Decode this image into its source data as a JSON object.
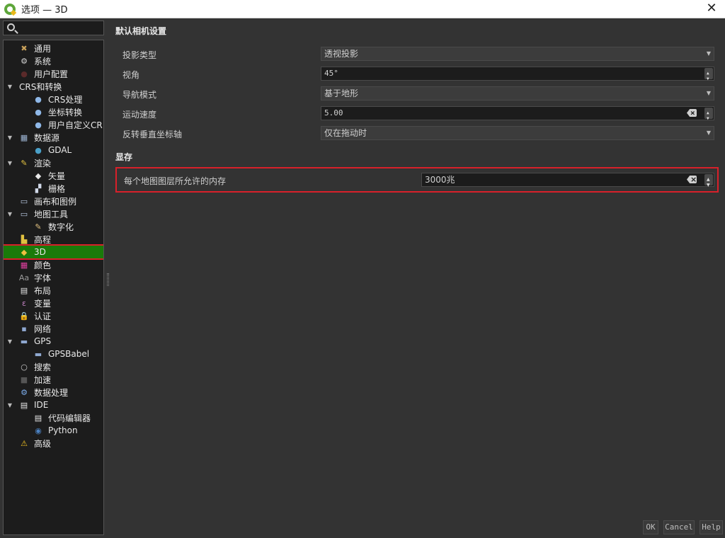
{
  "window": {
    "title": "选项 — 3D",
    "close": "✕"
  },
  "search": {
    "placeholder": ""
  },
  "tree": [
    {
      "label": "通用",
      "icon": "tools-icon",
      "glyph": "✖",
      "color": "#c9a15a",
      "level": 1,
      "arrow": ""
    },
    {
      "label": "系统",
      "icon": "system-gear-icon",
      "glyph": "⚙",
      "color": "#d8d8d8",
      "level": 1,
      "arrow": ""
    },
    {
      "label": "用户配置",
      "icon": "user-profile-icon",
      "glyph": "●",
      "color": "#5a2a2a",
      "level": 1,
      "arrow": ""
    },
    {
      "label": "CRS和转换",
      "icon": "",
      "glyph": "",
      "color": "",
      "level": 0,
      "arrow": "▼"
    },
    {
      "label": "CRS处理",
      "icon": "globe-icon",
      "glyph": "●",
      "color": "#8fb8e8",
      "level": 2,
      "arrow": ""
    },
    {
      "label": "坐标转换",
      "icon": "globe-transform-icon",
      "glyph": "●",
      "color": "#8fb8e8",
      "level": 2,
      "arrow": ""
    },
    {
      "label": "用户自定义CR",
      "icon": "globe-custom-icon",
      "glyph": "●",
      "color": "#8fb8e8",
      "level": 2,
      "arrow": ""
    },
    {
      "label": "数据源",
      "icon": "datasource-table-icon",
      "glyph": "▦",
      "color": "#9fb7d6",
      "level": 1,
      "arrow": "▼"
    },
    {
      "label": "GDAL",
      "icon": "gdal-globe-icon",
      "glyph": "●",
      "color": "#4aa0c8",
      "level": 2,
      "arrow": ""
    },
    {
      "label": "渲染",
      "icon": "brush-icon",
      "glyph": "✎",
      "color": "#e0c040",
      "level": 1,
      "arrow": "▼"
    },
    {
      "label": "矢量",
      "icon": "vector-icon",
      "glyph": "◆",
      "color": "#e8e8e8",
      "level": 2,
      "arrow": ""
    },
    {
      "label": "栅格",
      "icon": "raster-icon",
      "glyph": "▞",
      "color": "#d0d8e8",
      "level": 2,
      "arrow": ""
    },
    {
      "label": "画布和图例",
      "icon": "canvas-legend-icon",
      "glyph": "▭",
      "color": "#b8c8e0",
      "level": 1,
      "arrow": ""
    },
    {
      "label": "地图工具",
      "icon": "map-tools-icon",
      "glyph": "▭",
      "color": "#b8c8e0",
      "level": 1,
      "arrow": "▼"
    },
    {
      "label": "数字化",
      "icon": "digitizing-icon",
      "glyph": "✎",
      "color": "#e0c080",
      "level": 2,
      "arrow": ""
    },
    {
      "label": "高程",
      "icon": "elevation-icon",
      "glyph": "▙",
      "color": "#e0c040",
      "level": 1,
      "arrow": ""
    },
    {
      "label": "3D",
      "icon": "cube-3d-icon",
      "glyph": "◆",
      "color": "#f0c040",
      "level": 1,
      "arrow": "",
      "selected": true
    },
    {
      "label": "颜色",
      "icon": "color-palette-icon",
      "glyph": "▦",
      "color": "#e040a0",
      "level": 1,
      "arrow": ""
    },
    {
      "label": "字体",
      "icon": "font-icon",
      "glyph": "Aa",
      "color": "#9a9a9a",
      "level": 1,
      "arrow": ""
    },
    {
      "label": "布局",
      "icon": "layout-icon",
      "glyph": "▤",
      "color": "#e8e8e8",
      "level": 1,
      "arrow": ""
    },
    {
      "label": "变量",
      "icon": "variable-icon",
      "glyph": "ε",
      "color": "#c080c0",
      "level": 1,
      "arrow": ""
    },
    {
      "label": "认证",
      "icon": "lock-icon",
      "glyph": "🔒",
      "color": "#e0b020",
      "level": 1,
      "arrow": ""
    },
    {
      "label": "网络",
      "icon": "network-icon",
      "glyph": "▪",
      "color": "#8fa8d0",
      "level": 1,
      "arrow": ""
    },
    {
      "label": "GPS",
      "icon": "gps-icon",
      "glyph": "▬",
      "color": "#8fa8d0",
      "level": 1,
      "arrow": "▼"
    },
    {
      "label": "GPSBabel",
      "icon": "gpsbabel-icon",
      "glyph": "▬",
      "color": "#8fa8d0",
      "level": 2,
      "arrow": ""
    },
    {
      "label": "搜索",
      "icon": "search-icon",
      "glyph": "○",
      "color": "#cfcfcf",
      "level": 1,
      "arrow": ""
    },
    {
      "label": "加速",
      "icon": "acceleration-icon",
      "glyph": "■",
      "color": "#555555",
      "level": 1,
      "arrow": ""
    },
    {
      "label": "数据处理",
      "icon": "processing-gear-icon",
      "glyph": "⚙",
      "color": "#7fb0f0",
      "level": 1,
      "arrow": ""
    },
    {
      "label": "IDE",
      "icon": "ide-document-icon",
      "glyph": "▤",
      "color": "#e8e8e8",
      "level": 1,
      "arrow": "▼"
    },
    {
      "label": "代码编辑器",
      "icon": "code-editor-icon",
      "glyph": "▤",
      "color": "#e8e8e8",
      "level": 2,
      "arrow": ""
    },
    {
      "label": "Python",
      "icon": "python-icon",
      "glyph": "◉",
      "color": "#4a80c0",
      "level": 2,
      "arrow": ""
    },
    {
      "label": "高级",
      "icon": "warning-icon",
      "glyph": "⚠",
      "color": "#f0c020",
      "level": 1,
      "arrow": ""
    }
  ],
  "camera": {
    "title": "默认相机设置",
    "projection_label": "投影类型",
    "projection_value": "透视投影",
    "fov_label": "视角",
    "fov_value": "45°",
    "nav_label": "导航模式",
    "nav_value": "基于地形",
    "speed_label": "运动速度",
    "speed_value": "5.00",
    "invert_label": "反转垂直坐标轴",
    "invert_value": "仅在拖动时"
  },
  "memory": {
    "title": "显存",
    "label": "每个地图图层所允许的内存",
    "value": "3000兆"
  },
  "buttons": {
    "ok": "OK",
    "cancel": "Cancel",
    "help": "Help"
  },
  "colors": {
    "selected_bg": "#1a7a0a",
    "highlight_border": "#d8202a"
  }
}
